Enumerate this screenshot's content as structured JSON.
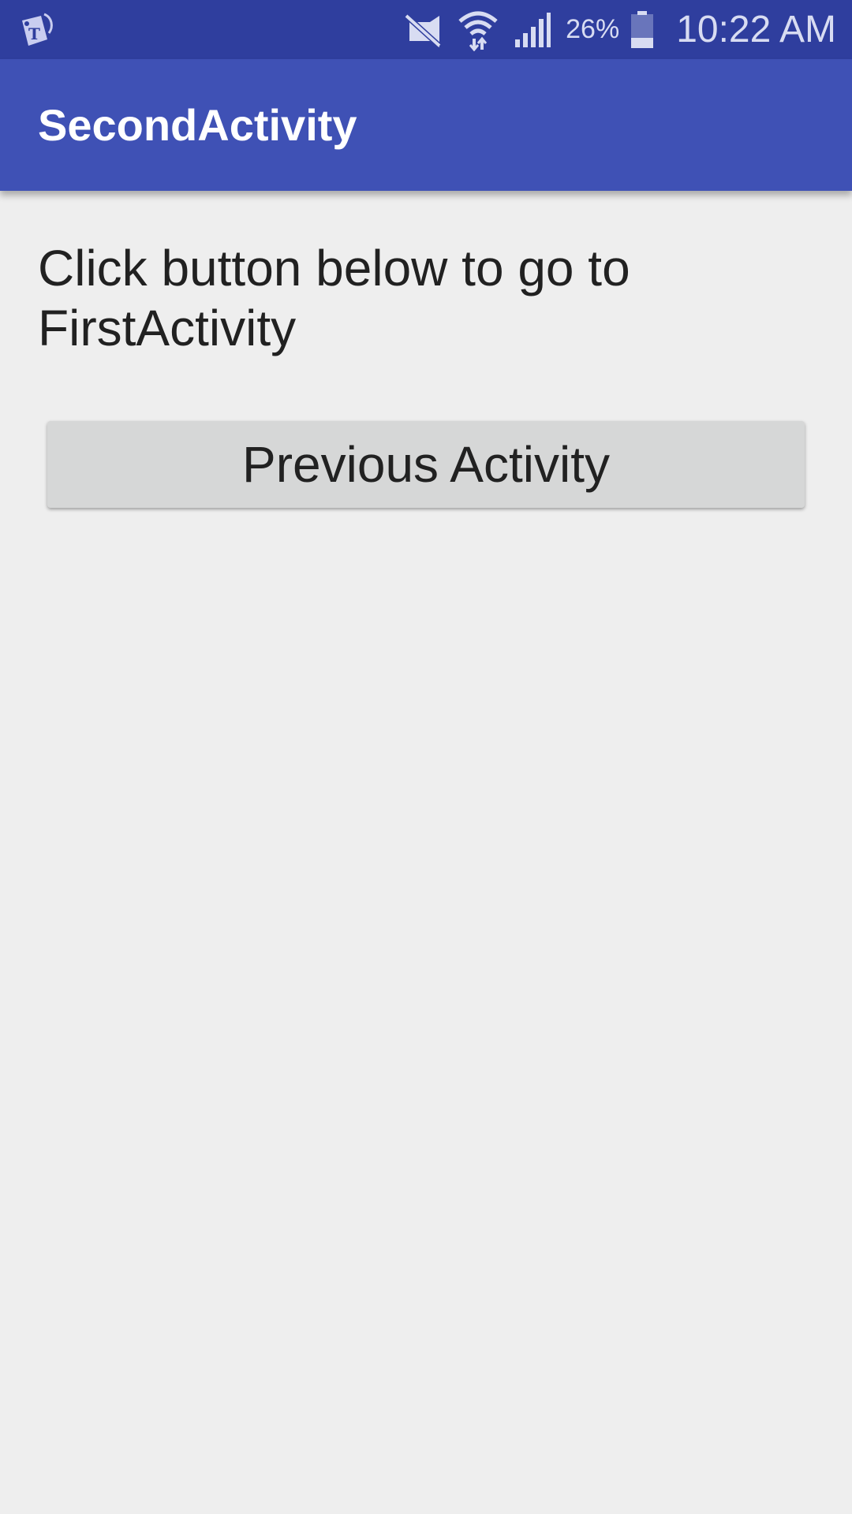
{
  "status_bar": {
    "left_icon": "tmobile-notification-icon",
    "mute_icon": "mute-icon",
    "wifi_icon": "wifi-icon",
    "signal_icon": "signal-icon",
    "battery_percent": "26%",
    "battery_icon": "battery-icon",
    "battery_level": 0.26,
    "time": "10:22 AM"
  },
  "app_bar": {
    "title": "SecondActivity"
  },
  "content": {
    "message": "Click button below to go to FirstActivity",
    "button_label": "Previous Activity"
  },
  "colors": {
    "status_bar": "#2f3e9e",
    "app_bar": "#3f51b5",
    "background": "#eeeeee",
    "button": "#d6d7d7",
    "text": "#212121"
  }
}
